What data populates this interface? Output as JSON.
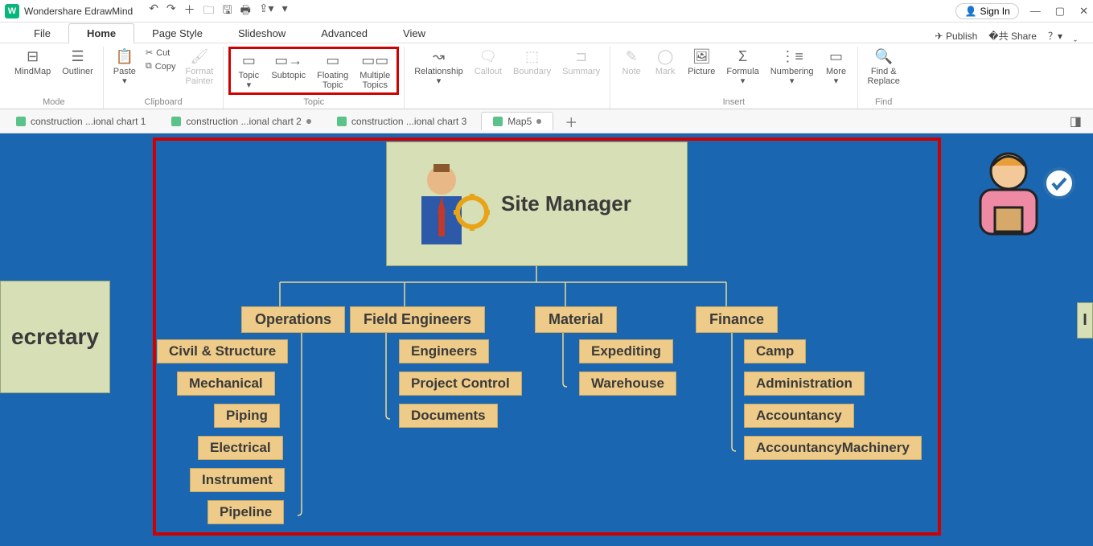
{
  "app": {
    "title": "Wondershare EdrawMind",
    "signin": "Sign In"
  },
  "menus": {
    "file": "File",
    "home": "Home",
    "pagestyle": "Page Style",
    "slideshow": "Slideshow",
    "advanced": "Advanced",
    "view": "View",
    "publish": "Publish",
    "share": "Share"
  },
  "ribbon": {
    "mode": {
      "mindmap": "MindMap",
      "outliner": "Outliner",
      "label": "Mode"
    },
    "clipboard": {
      "paste": "Paste",
      "cut": "Cut",
      "copy": "Copy",
      "formatpainter1": "Format",
      "formatpainter2": "Painter",
      "label": "Clipboard"
    },
    "topic": {
      "topic": "Topic",
      "subtopic": "Subtopic",
      "floating1": "Floating",
      "floating2": "Topic",
      "multiple1": "Multiple",
      "multiple2": "Topics",
      "label": "Topic"
    },
    "other": {
      "relationship": "Relationship",
      "callout": "Callout",
      "boundary": "Boundary",
      "summary": "Summary"
    },
    "insert": {
      "note": "Note",
      "mark": "Mark",
      "picture": "Picture",
      "formula": "Formula",
      "numbering": "Numbering",
      "more": "More",
      "label": "Insert"
    },
    "find": {
      "line1": "Find &",
      "line2": "Replace",
      "label": "Find"
    }
  },
  "doctabs": {
    "t1": "construction ...ional chart 1",
    "t2": "construction ...ional chart 2",
    "t3": "construction ...ional chart 3",
    "t4": "Map5"
  },
  "chart": {
    "left_partial": "ecretary",
    "right_partial": "I",
    "root": "Site Manager",
    "branches": {
      "operations": {
        "label": "Operations",
        "items": [
          "Civil & Structure",
          "Mechanical",
          "Piping",
          "Electrical",
          "Instrument",
          "Pipeline"
        ]
      },
      "field": {
        "label": "Field Engineers",
        "items": [
          "Engineers",
          "Project Control",
          "Documents"
        ]
      },
      "material": {
        "label": "Material",
        "items": [
          "Expediting",
          "Warehouse"
        ]
      },
      "finance": {
        "label": "Finance",
        "items": [
          "Camp",
          "Administration",
          "Accountancy",
          "AccountancyMachinery"
        ]
      }
    }
  }
}
